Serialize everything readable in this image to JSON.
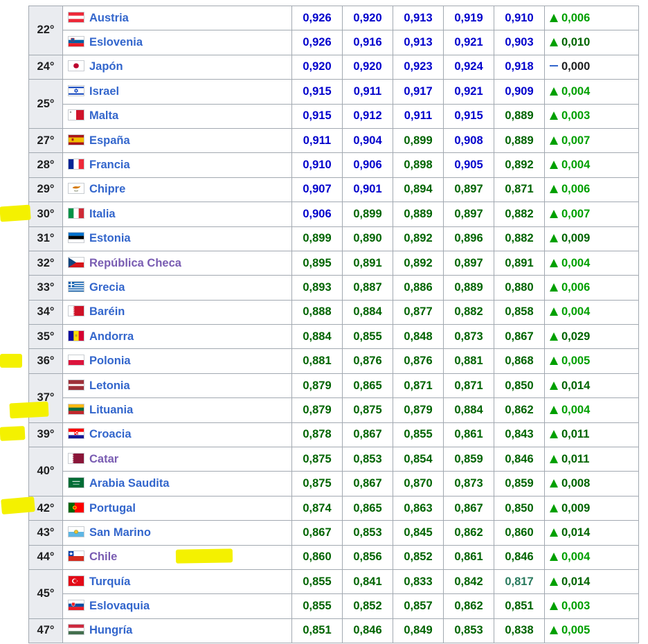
{
  "colors": {
    "very_high_blue": "#0000cc",
    "high_green": "#006400",
    "increase_green": "#00a000",
    "link": "#3366cc",
    "visited_link": "#795cb2",
    "highlight": "#f4f100",
    "rank_bg": "#eaecf0",
    "border": "#a2a9b1"
  },
  "rows": [
    {
      "rank": "22°",
      "span": 2,
      "country": "Austria",
      "flag": "austria-flag",
      "values": [
        "0,926",
        "0,920",
        "0,913",
        "0,919",
        "0,910"
      ],
      "colors": [
        "blue",
        "blue",
        "blue",
        "blue",
        "blue"
      ],
      "trend": "up",
      "change": "0,006",
      "change_color": "light"
    },
    {
      "country": "Eslovenia",
      "flag": "slovenia-flag",
      "values": [
        "0,926",
        "0,916",
        "0,913",
        "0,921",
        "0,903"
      ],
      "colors": [
        "blue",
        "blue",
        "blue",
        "blue",
        "blue"
      ],
      "trend": "up",
      "change": "0,010",
      "change_color": "dark"
    },
    {
      "rank": "24°",
      "span": 1,
      "country": "Japón",
      "flag": "japan-flag",
      "values": [
        "0,920",
        "0,920",
        "0,923",
        "0,924",
        "0,918"
      ],
      "colors": [
        "blue",
        "blue",
        "blue",
        "blue",
        "blue"
      ],
      "trend": "same",
      "change": "0,000",
      "change_color": "black"
    },
    {
      "rank": "25°",
      "span": 2,
      "country": "Israel",
      "flag": "israel-flag",
      "values": [
        "0,915",
        "0,911",
        "0,917",
        "0,921",
        "0,909"
      ],
      "colors": [
        "blue",
        "blue",
        "blue",
        "blue",
        "blue"
      ],
      "trend": "up",
      "change": "0,004",
      "change_color": "light"
    },
    {
      "country": "Malta",
      "flag": "malta-flag",
      "values": [
        "0,915",
        "0,912",
        "0,911",
        "0,915",
        "0,889"
      ],
      "colors": [
        "blue",
        "blue",
        "blue",
        "blue",
        "green"
      ],
      "trend": "up",
      "change": "0,003",
      "change_color": "light"
    },
    {
      "rank": "27°",
      "span": 1,
      "country": "España",
      "flag": "spain-flag",
      "values": [
        "0,911",
        "0,904",
        "0,899",
        "0,908",
        "0,889"
      ],
      "colors": [
        "blue",
        "blue",
        "green",
        "blue",
        "green"
      ],
      "trend": "up",
      "change": "0,007",
      "change_color": "light"
    },
    {
      "rank": "28°",
      "span": 1,
      "country": "Francia",
      "flag": "france-flag",
      "values": [
        "0,910",
        "0,906",
        "0,898",
        "0,905",
        "0,892"
      ],
      "colors": [
        "blue",
        "blue",
        "green",
        "blue",
        "green"
      ],
      "trend": "up",
      "change": "0,004",
      "change_color": "light"
    },
    {
      "rank": "29°",
      "span": 1,
      "country": "Chipre",
      "flag": "cyprus-flag",
      "values": [
        "0,907",
        "0,901",
        "0,894",
        "0,897",
        "0,871"
      ],
      "colors": [
        "blue",
        "blue",
        "green",
        "green",
        "green"
      ],
      "trend": "up",
      "change": "0,006",
      "change_color": "light"
    },
    {
      "rank": "30°",
      "span": 1,
      "country": "Italia",
      "flag": "italy-flag",
      "values": [
        "0,906",
        "0,899",
        "0,889",
        "0,897",
        "0,882"
      ],
      "colors": [
        "blue",
        "green",
        "green",
        "green",
        "green"
      ],
      "trend": "up",
      "change": "0,007",
      "change_color": "light"
    },
    {
      "rank": "31°",
      "span": 1,
      "country": "Estonia",
      "flag": "estonia-flag",
      "values": [
        "0,899",
        "0,890",
        "0,892",
        "0,896",
        "0,882"
      ],
      "colors": [
        "green",
        "green",
        "green",
        "green",
        "green"
      ],
      "trend": "up",
      "change": "0,009",
      "change_color": "dark"
    },
    {
      "rank": "32°",
      "span": 1,
      "country": "República Checa",
      "visited": true,
      "flag": "czech-flag",
      "values": [
        "0,895",
        "0,891",
        "0,892",
        "0,897",
        "0,891"
      ],
      "colors": [
        "green",
        "green",
        "green",
        "green",
        "green"
      ],
      "trend": "up",
      "change": "0,004",
      "change_color": "light"
    },
    {
      "rank": "33°",
      "span": 1,
      "country": "Grecia",
      "flag": "greece-flag",
      "values": [
        "0,893",
        "0,887",
        "0,886",
        "0,889",
        "0,880"
      ],
      "colors": [
        "green",
        "green",
        "green",
        "green",
        "green"
      ],
      "trend": "up",
      "change": "0,006",
      "change_color": "light"
    },
    {
      "rank": "34°",
      "span": 1,
      "country": "Baréin",
      "flag": "bahrain-flag",
      "values": [
        "0,888",
        "0,884",
        "0,877",
        "0,882",
        "0,858"
      ],
      "colors": [
        "green",
        "green",
        "green",
        "green",
        "green"
      ],
      "trend": "up",
      "change": "0,004",
      "change_color": "light"
    },
    {
      "rank": "35°",
      "span": 1,
      "country": "Andorra",
      "flag": "andorra-flag",
      "values": [
        "0,884",
        "0,855",
        "0,848",
        "0,873",
        "0,867"
      ],
      "colors": [
        "green",
        "green",
        "green",
        "green",
        "green"
      ],
      "trend": "up",
      "change": "0,029",
      "change_color": "dark"
    },
    {
      "rank": "36°",
      "span": 1,
      "country": "Polonia",
      "flag": "poland-flag",
      "values": [
        "0,881",
        "0,876",
        "0,876",
        "0,881",
        "0,868"
      ],
      "colors": [
        "green",
        "green",
        "green",
        "green",
        "green"
      ],
      "trend": "up",
      "change": "0,005",
      "change_color": "light"
    },
    {
      "rank": "37°",
      "span": 2,
      "country": "Letonia",
      "flag": "latvia-flag",
      "values": [
        "0,879",
        "0,865",
        "0,871",
        "0,871",
        "0,850"
      ],
      "colors": [
        "green",
        "green",
        "green",
        "green",
        "green"
      ],
      "trend": "up",
      "change": "0,014",
      "change_color": "dark"
    },
    {
      "country": "Lituania",
      "flag": "lithuania-flag",
      "values": [
        "0,879",
        "0,875",
        "0,879",
        "0,884",
        "0,862"
      ],
      "colors": [
        "green",
        "green",
        "green",
        "green",
        "green"
      ],
      "trend": "up",
      "change": "0,004",
      "change_color": "light"
    },
    {
      "rank": "39°",
      "span": 1,
      "country": "Croacia",
      "flag": "croatia-flag",
      "values": [
        "0,878",
        "0,867",
        "0,855",
        "0,861",
        "0,843"
      ],
      "colors": [
        "green",
        "green",
        "green",
        "green",
        "green"
      ],
      "trend": "up",
      "change": "0,011",
      "change_color": "dark"
    },
    {
      "rank": "40°",
      "span": 2,
      "country": "Catar",
      "visited": true,
      "flag": "qatar-flag",
      "values": [
        "0,875",
        "0,853",
        "0,854",
        "0,859",
        "0,846"
      ],
      "colors": [
        "green",
        "green",
        "green",
        "green",
        "green"
      ],
      "trend": "up",
      "change": "0,011",
      "change_color": "dark"
    },
    {
      "country": "Arabia Saudita",
      "flag": "saudi-arabia-flag",
      "values": [
        "0,875",
        "0,867",
        "0,870",
        "0,873",
        "0,859"
      ],
      "colors": [
        "green",
        "green",
        "green",
        "green",
        "green"
      ],
      "trend": "up",
      "change": "0,008",
      "change_color": "dark"
    },
    {
      "rank": "42°",
      "span": 1,
      "country": "Portugal",
      "flag": "portugal-flag",
      "values": [
        "0,874",
        "0,865",
        "0,863",
        "0,867",
        "0,850"
      ],
      "colors": [
        "green",
        "green",
        "green",
        "green",
        "green"
      ],
      "trend": "up",
      "change": "0,009",
      "change_color": "dark"
    },
    {
      "rank": "43°",
      "span": 1,
      "country": "San Marino",
      "flag": "san-marino-flag",
      "values": [
        "0,867",
        "0,853",
        "0,845",
        "0,862",
        "0,860"
      ],
      "colors": [
        "green",
        "green",
        "green",
        "green",
        "green"
      ],
      "trend": "up",
      "change": "0,014",
      "change_color": "dark"
    },
    {
      "rank": "44°",
      "span": 1,
      "country": "Chile",
      "visited": true,
      "flag": "chile-flag",
      "values": [
        "0,860",
        "0,856",
        "0,852",
        "0,861",
        "0,846"
      ],
      "colors": [
        "green",
        "green",
        "green",
        "green",
        "green"
      ],
      "trend": "up",
      "change": "0,004",
      "change_color": "light"
    },
    {
      "rank": "45°",
      "span": 2,
      "country": "Turquía",
      "flag": "turkey-flag",
      "values": [
        "0,855",
        "0,841",
        "0,833",
        "0,842",
        "0,817"
      ],
      "colors": [
        "green",
        "green",
        "green",
        "green",
        "teal"
      ],
      "trend": "up",
      "change": "0,014",
      "change_color": "dark"
    },
    {
      "country": "Eslovaquia",
      "flag": "slovakia-flag",
      "values": [
        "0,855",
        "0,852",
        "0,857",
        "0,862",
        "0,851"
      ],
      "colors": [
        "green",
        "green",
        "green",
        "green",
        "green"
      ],
      "trend": "up",
      "change": "0,003",
      "change_color": "light"
    },
    {
      "rank": "47°",
      "span": 1,
      "country": "Hungría",
      "flag": "hungary-flag",
      "values": [
        "0,851",
        "0,846",
        "0,849",
        "0,853",
        "0,838"
      ],
      "colors": [
        "green",
        "green",
        "green",
        "green",
        "green"
      ],
      "trend": "up",
      "change": "0,005",
      "change_color": "light"
    }
  ]
}
